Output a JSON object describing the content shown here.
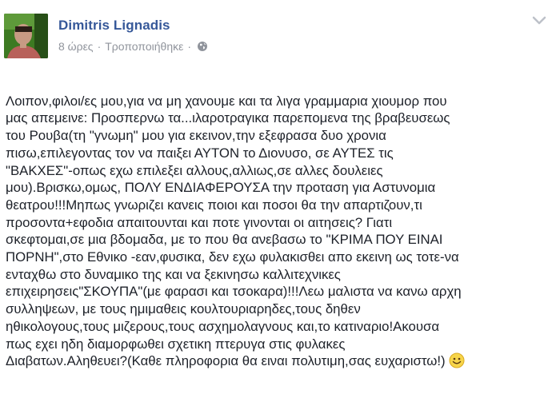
{
  "post": {
    "author": "Dimitris Lignadis",
    "time": "8 ώρες",
    "edited": "Τροποποιήθηκε",
    "separator": "·",
    "privacy_icon": "globe-icon",
    "options_icon": "chevron-down-icon",
    "body": "Λοιπον,φιλοι/ες μου,για να μη χανουμε και τα λιγα γραμμαρια χιουμορ που\nμας απεμεινε: Προσπερνω τα...ιλαροτραγικα παρεπομενα της βραβευσεως\nτου Ρουβα(τη \"γνωμη\" μου για εκεινον,την εξεφρασα δυο χρονια\nπισω,επιλεγοντας τον να παιξει ΑΥΤΟΝ το Διονυσο, σε ΑΥΤΕΣ τις\n\"ΒΑΚΧΕΣ\"-οπως εχω επιλεξει αλλους,αλλιως,σε αλλες δουλειες\nμου).Βρισκω,ομως, ΠΟΛΥ ΕΝΔΙΑΦΕΡΟΥΣΑ την προταση για Αστυνομια\nθεατρου!!!Μηπως γνωριζει κανεις ποιοι και ποσοι θα την απαρτιζουν,τι\nπροσοντα+εφοδια απαιτουνται και ποτε γινονται οι αιτησεις? Γιατι\nσκεφτομαι,σε μια βδομαδα, με το που θα ανεβασω το \"ΚΡΙΜΑ ΠΟΥ ΕΙΝΑΙ\nΠΟΡΝΗ\",στο Εθνικο -εαν,φυσικα, δεν εχω φυλακισθει απο εκεινη ως τοτε-να\nενταχθω στο δυναμικο της και να ξεκινησω καλλιτεχνικες\nεπιχειρησεις\"ΣΚΟΥΠΑ\"(με φαρασι και τσοκαρα)!!!Λεω μαλιστα να κανω αρχη\nσυλληψεων, με τους ημιμαθεις κουλτουριαρηδες,τους δηθεν\nηθικολογους,τους μιζερους,τους ασχημολαγνους και,το κατιναριο!Ακουσα\nπως εχει ηδη διαμορφωθει σχετικη πτερυγα στις φυλακες\nΔιαβατων.Αληθευει?(Καθε πληροφορια θα ειναι πολυτιμη,σας ευχαριστω!)",
    "emoji_icon": "smiley-icon",
    "colors": {
      "author": "#365899",
      "meta": "#90949c",
      "text": "#1d2129"
    }
  }
}
